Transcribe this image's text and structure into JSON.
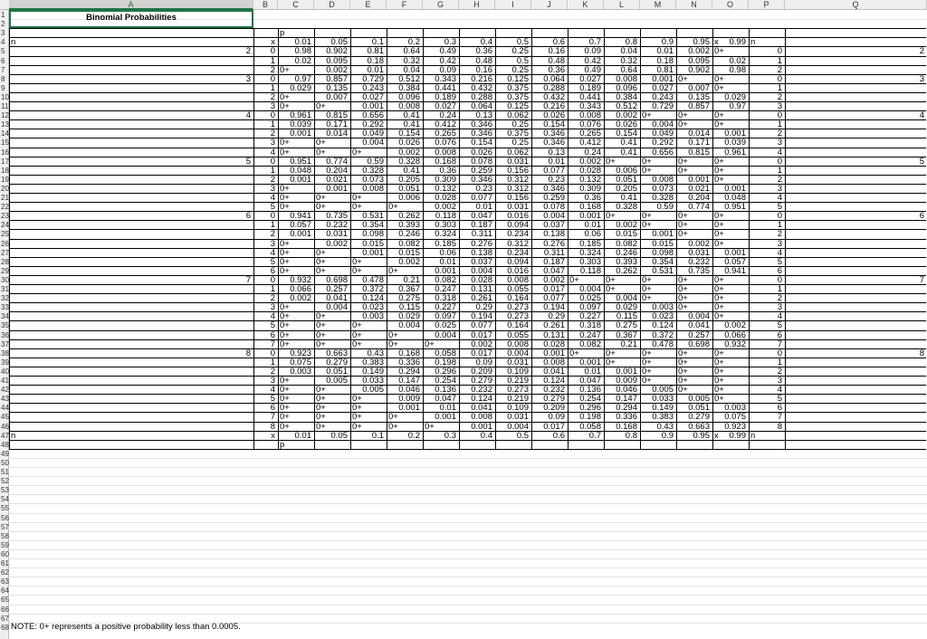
{
  "columns": [
    "A",
    "B",
    "C",
    "D",
    "E",
    "F",
    "G",
    "H",
    "I",
    "J",
    "K",
    "L",
    "M",
    "N",
    "O",
    "P",
    "Q"
  ],
  "row_numbers": [
    "1",
    "2",
    "3",
    "4",
    "5",
    "6",
    "7",
    "8",
    "9",
    "10",
    "11",
    "12",
    "13",
    "14",
    "15",
    "16",
    "17",
    "18",
    "19",
    "20",
    "21",
    "22",
    "23",
    "24",
    "25",
    "26",
    "27",
    "28",
    "29",
    "30",
    "31",
    "32",
    "33",
    "34",
    "35",
    "36",
    "37",
    "38",
    "39",
    "40",
    "41",
    "42",
    "43",
    "44",
    "45",
    "46",
    "47",
    "48",
    "49",
    "50",
    "51",
    "52",
    "53",
    "54",
    "55",
    "56",
    "57",
    "58",
    "59",
    "60",
    "61",
    "62",
    "63",
    "64",
    "65",
    "66",
    "67",
    "68"
  ],
  "title": "Binomial Probabilities",
  "p_label": "p",
  "n_label": "n",
  "x_label": "x",
  "p_values": [
    "0.01",
    "0.05",
    "0.1",
    "0.2",
    "0.3",
    "0.4",
    "0.5",
    "0.6",
    "0.7",
    "0.8",
    "0.9",
    "0.95",
    "0.99"
  ],
  "note": "NOTE: 0+ represents a positive probability less than 0.0005.",
  "rows": [
    {
      "n": "2",
      "x": "0",
      "v": [
        "0.98",
        "0.902",
        "0.81",
        "0.64",
        "0.49",
        "0.36",
        "0.25",
        "0.16",
        "0.09",
        "0.04",
        "0.01",
        "0.002",
        "0+"
      ]
    },
    {
      "n": "",
      "x": "1",
      "v": [
        "0.02",
        "0.095",
        "0.18",
        "0.32",
        "0.42",
        "0.48",
        "0.5",
        "0.48",
        "0.42",
        "0.32",
        "0.18",
        "0.095",
        "0.02"
      ]
    },
    {
      "n": "",
      "x": "2",
      "v": [
        "0+",
        "0.002",
        "0.01",
        "0.04",
        "0.09",
        "0.16",
        "0.25",
        "0.36",
        "0.49",
        "0.64",
        "0.81",
        "0.902",
        "0.98"
      ]
    },
    {
      "n": "3",
      "x": "0",
      "v": [
        "0.97",
        "0.857",
        "0.729",
        "0.512",
        "0.343",
        "0.216",
        "0.125",
        "0.064",
        "0.027",
        "0.008",
        "0.001",
        "0+",
        "0+"
      ]
    },
    {
      "n": "",
      "x": "1",
      "v": [
        "0.029",
        "0.135",
        "0.243",
        "0.384",
        "0.441",
        "0.432",
        "0.375",
        "0.288",
        "0.189",
        "0.096",
        "0.027",
        "0.007",
        "0+"
      ]
    },
    {
      "n": "",
      "x": "2",
      "v": [
        "0+",
        "0.007",
        "0.027",
        "0.096",
        "0.189",
        "0.288",
        "0.375",
        "0.432",
        "0.441",
        "0.384",
        "0.243",
        "0.135",
        "0.029"
      ]
    },
    {
      "n": "",
      "x": "3",
      "v": [
        "0+",
        "0+",
        "0.001",
        "0.008",
        "0.027",
        "0.064",
        "0.125",
        "0.216",
        "0.343",
        "0.512",
        "0.729",
        "0.857",
        "0.97"
      ]
    },
    {
      "n": "4",
      "x": "0",
      "v": [
        "0.961",
        "0.815",
        "0.656",
        "0.41",
        "0.24",
        "0.13",
        "0.062",
        "0.026",
        "0.008",
        "0.002",
        "0+",
        "0+",
        "0+"
      ]
    },
    {
      "n": "",
      "x": "1",
      "v": [
        "0.039",
        "0.171",
        "0.292",
        "0.41",
        "0.412",
        "0.346",
        "0.25",
        "0.154",
        "0.076",
        "0.026",
        "0.004",
        "0+",
        "0+"
      ]
    },
    {
      "n": "",
      "x": "2",
      "v": [
        "0.001",
        "0.014",
        "0.049",
        "0.154",
        "0.265",
        "0.346",
        "0.375",
        "0.346",
        "0.265",
        "0.154",
        "0.049",
        "0.014",
        "0.001"
      ]
    },
    {
      "n": "",
      "x": "3",
      "v": [
        "0+",
        "0+",
        "0.004",
        "0.026",
        "0.076",
        "0.154",
        "0.25",
        "0.346",
        "0.412",
        "0.41",
        "0.292",
        "0.171",
        "0.039"
      ]
    },
    {
      "n": "",
      "x": "4",
      "v": [
        "0+",
        "0+",
        "0+",
        "0.002",
        "0.008",
        "0.026",
        "0.062",
        "0.13",
        "0.24",
        "0.41",
        "0.656",
        "0.815",
        "0.961"
      ]
    },
    {
      "n": "5",
      "x": "0",
      "v": [
        "0.951",
        "0.774",
        "0.59",
        "0.328",
        "0.168",
        "0.078",
        "0.031",
        "0.01",
        "0.002",
        "0+",
        "0+",
        "0+",
        "0+"
      ]
    },
    {
      "n": "",
      "x": "1",
      "v": [
        "0.048",
        "0.204",
        "0.328",
        "0.41",
        "0.36",
        "0.259",
        "0.156",
        "0.077",
        "0.028",
        "0.006",
        "0+",
        "0+",
        "0+"
      ]
    },
    {
      "n": "",
      "x": "2",
      "v": [
        "0.001",
        "0.021",
        "0.073",
        "0.205",
        "0.309",
        "0.346",
        "0.312",
        "0.23",
        "0.132",
        "0.051",
        "0.008",
        "0.001",
        "0+"
      ]
    },
    {
      "n": "",
      "x": "3",
      "v": [
        "0+",
        "0.001",
        "0.008",
        "0.051",
        "0.132",
        "0.23",
        "0.312",
        "0.346",
        "0.309",
        "0.205",
        "0.073",
        "0.021",
        "0.001"
      ]
    },
    {
      "n": "",
      "x": "4",
      "v": [
        "0+",
        "0+",
        "0+",
        "0.006",
        "0.028",
        "0.077",
        "0.156",
        "0.259",
        "0.36",
        "0.41",
        "0.328",
        "0.204",
        "0.048"
      ]
    },
    {
      "n": "",
      "x": "5",
      "v": [
        "0+",
        "0+",
        "0+",
        "0+",
        "0.002",
        "0.01",
        "0.031",
        "0.078",
        "0.168",
        "0.328",
        "0.59",
        "0.774",
        "0.951"
      ]
    },
    {
      "n": "6",
      "x": "0",
      "v": [
        "0.941",
        "0.735",
        "0.531",
        "0.262",
        "0.118",
        "0.047",
        "0.016",
        "0.004",
        "0.001",
        "0+",
        "0+",
        "0+",
        "0+"
      ]
    },
    {
      "n": "",
      "x": "1",
      "v": [
        "0.057",
        "0.232",
        "0.354",
        "0.393",
        "0.303",
        "0.187",
        "0.094",
        "0.037",
        "0.01",
        "0.002",
        "0+",
        "0+",
        "0+"
      ]
    },
    {
      "n": "",
      "x": "2",
      "v": [
        "0.001",
        "0.031",
        "0.098",
        "0.246",
        "0.324",
        "0.311",
        "0.234",
        "0.138",
        "0.06",
        "0.015",
        "0.001",
        "0+",
        "0+"
      ]
    },
    {
      "n": "",
      "x": "3",
      "v": [
        "0+",
        "0.002",
        "0.015",
        "0.082",
        "0.185",
        "0.276",
        "0.312",
        "0.276",
        "0.185",
        "0.082",
        "0.015",
        "0.002",
        "0+"
      ]
    },
    {
      "n": "",
      "x": "4",
      "v": [
        "0+",
        "0+",
        "0.001",
        "0.015",
        "0.06",
        "0.138",
        "0.234",
        "0.311",
        "0.324",
        "0.246",
        "0.098",
        "0.031",
        "0.001"
      ]
    },
    {
      "n": "",
      "x": "5",
      "v": [
        "0+",
        "0+",
        "0+",
        "0.002",
        "0.01",
        "0.037",
        "0.094",
        "0.187",
        "0.303",
        "0.393",
        "0.354",
        "0.232",
        "0.057"
      ]
    },
    {
      "n": "",
      "x": "6",
      "v": [
        "0+",
        "0+",
        "0+",
        "0+",
        "0.001",
        "0.004",
        "0.016",
        "0.047",
        "0.118",
        "0.262",
        "0.531",
        "0.735",
        "0.941"
      ]
    },
    {
      "n": "7",
      "x": "0",
      "v": [
        "0.932",
        "0.698",
        "0.478",
        "0.21",
        "0.082",
        "0.028",
        "0.008",
        "0.002",
        "0+",
        "0+",
        "0+",
        "0+",
        "0+"
      ]
    },
    {
      "n": "",
      "x": "1",
      "v": [
        "0.066",
        "0.257",
        "0.372",
        "0.367",
        "0.247",
        "0.131",
        "0.055",
        "0.017",
        "0.004",
        "0+",
        "0+",
        "0+",
        "0+"
      ]
    },
    {
      "n": "",
      "x": "2",
      "v": [
        "0.002",
        "0.041",
        "0.124",
        "0.275",
        "0.318",
        "0.261",
        "0.164",
        "0.077",
        "0.025",
        "0.004",
        "0+",
        "0+",
        "0+"
      ]
    },
    {
      "n": "",
      "x": "3",
      "v": [
        "0+",
        "0.004",
        "0.023",
        "0.115",
        "0.227",
        "0.29",
        "0.273",
        "0.194",
        "0.097",
        "0.029",
        "0.003",
        "0+",
        "0+"
      ]
    },
    {
      "n": "",
      "x": "4",
      "v": [
        "0+",
        "0+",
        "0.003",
        "0.029",
        "0.097",
        "0.194",
        "0.273",
        "0.29",
        "0.227",
        "0.115",
        "0.023",
        "0.004",
        "0+"
      ]
    },
    {
      "n": "",
      "x": "5",
      "v": [
        "0+",
        "0+",
        "0+",
        "0.004",
        "0.025",
        "0.077",
        "0.164",
        "0.261",
        "0.318",
        "0.275",
        "0.124",
        "0.041",
        "0.002"
      ]
    },
    {
      "n": "",
      "x": "6",
      "v": [
        "0+",
        "0+",
        "0+",
        "0+",
        "0.004",
        "0.017",
        "0.055",
        "0.131",
        "0.247",
        "0.367",
        "0.372",
        "0.257",
        "0.066"
      ]
    },
    {
      "n": "",
      "x": "7",
      "v": [
        "0+",
        "0+",
        "0+",
        "0+",
        "0+",
        "0.002",
        "0.008",
        "0.028",
        "0.082",
        "0.21",
        "0.478",
        "0.698",
        "0.932"
      ]
    },
    {
      "n": "8",
      "x": "0",
      "v": [
        "0.923",
        "0.663",
        "0.43",
        "0.168",
        "0.058",
        "0.017",
        "0.004",
        "0.001",
        "0+",
        "0+",
        "0+",
        "0+",
        "0+"
      ]
    },
    {
      "n": "",
      "x": "1",
      "v": [
        "0.075",
        "0.279",
        "0.383",
        "0.336",
        "0.198",
        "0.09",
        "0.031",
        "0.008",
        "0.001",
        "0+",
        "0+",
        "0+",
        "0+"
      ]
    },
    {
      "n": "",
      "x": "2",
      "v": [
        "0.003",
        "0.051",
        "0.149",
        "0.294",
        "0.296",
        "0.209",
        "0.109",
        "0.041",
        "0.01",
        "0.001",
        "0+",
        "0+",
        "0+"
      ]
    },
    {
      "n": "",
      "x": "3",
      "v": [
        "0+",
        "0.005",
        "0.033",
        "0.147",
        "0.254",
        "0.279",
        "0.219",
        "0.124",
        "0.047",
        "0.009",
        "0+",
        "0+",
        "0+"
      ]
    },
    {
      "n": "",
      "x": "4",
      "v": [
        "0+",
        "0+",
        "0.005",
        "0.046",
        "0.136",
        "0.232",
        "0.273",
        "0.232",
        "0.136",
        "0.046",
        "0.005",
        "0+",
        "0+"
      ]
    },
    {
      "n": "",
      "x": "5",
      "v": [
        "0+",
        "0+",
        "0+",
        "0.009",
        "0.047",
        "0.124",
        "0.219",
        "0.279",
        "0.254",
        "0.147",
        "0.033",
        "0.005",
        "0+"
      ]
    },
    {
      "n": "",
      "x": "6",
      "v": [
        "0+",
        "0+",
        "0+",
        "0.001",
        "0.01",
        "0.041",
        "0.109",
        "0.209",
        "0.296",
        "0.294",
        "0.149",
        "0.051",
        "0.003"
      ]
    },
    {
      "n": "",
      "x": "7",
      "v": [
        "0+",
        "0+",
        "0+",
        "0+",
        "0.001",
        "0.008",
        "0.031",
        "0.09",
        "0.198",
        "0.336",
        "0.383",
        "0.279",
        "0.075"
      ]
    },
    {
      "n": "",
      "x": "8",
      "v": [
        "0+",
        "0+",
        "0+",
        "0+",
        "0+",
        "0.001",
        "0.004",
        "0.017",
        "0.058",
        "0.168",
        "0.43",
        "0.663",
        "0.923"
      ]
    }
  ]
}
